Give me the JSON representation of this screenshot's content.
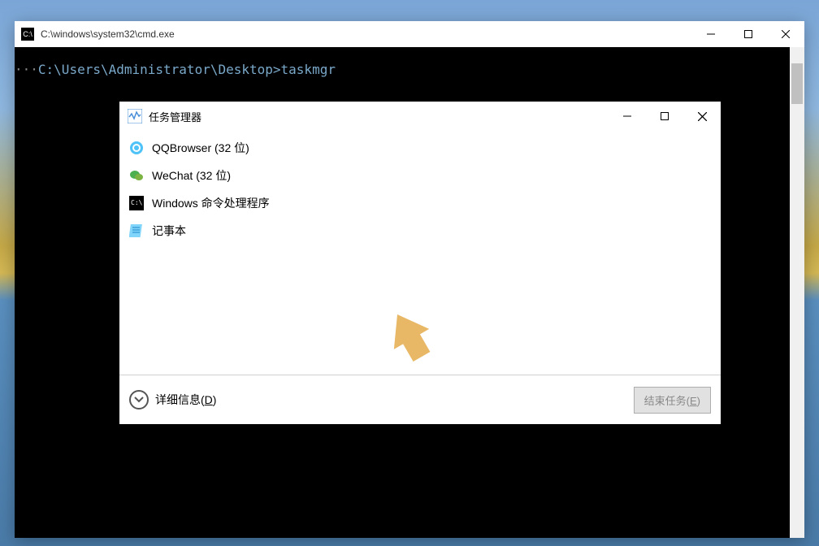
{
  "cmd": {
    "title": "C:\\windows\\system32\\cmd.exe",
    "icon_text": "C:\\",
    "prompt_prefix": "···",
    "prompt": "C:\\Users\\Administrator\\Desktop>",
    "command": "taskmgr"
  },
  "taskmgr": {
    "title": "任务管理器",
    "processes": [
      {
        "name": "QQBrowser (32 位)",
        "icon": "qq"
      },
      {
        "name": "WeChat (32 位)",
        "icon": "wechat"
      },
      {
        "name": "Windows 命令处理程序",
        "icon": "cmd"
      },
      {
        "name": "记事本",
        "icon": "notepad"
      }
    ],
    "details_label": "详细信息(",
    "details_key": "D",
    "details_close": ")",
    "end_task_label": "结束任务(",
    "end_task_key": "E",
    "end_task_close": ")"
  }
}
